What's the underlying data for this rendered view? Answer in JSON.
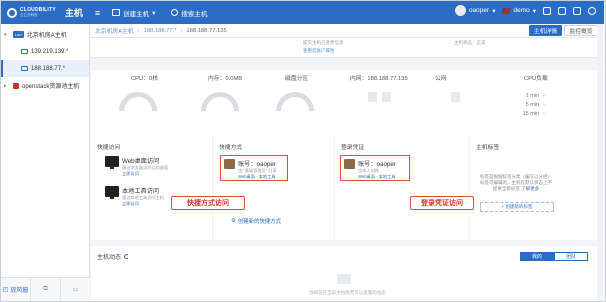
{
  "topbar": {
    "brand": "CLOUDBILITY",
    "brand_sub": "云立方科技",
    "app_title": "主机",
    "menu_icon": "hamburger-icon",
    "create_host": "创建主机",
    "search_host": "搜索主机",
    "user": "oaoper",
    "project": "demo",
    "colors": {
      "bar": "#2b6cc4"
    }
  },
  "sidebar": {
    "items": [
      {
        "toggle": "▾",
        "badge": "Lan",
        "label": "北京机房A主机",
        "level": 0
      },
      {
        "label": "139.219.139.*",
        "level": 1
      },
      {
        "label": "188.188.77.*",
        "level": 1,
        "active": true
      },
      {
        "toggle": "▸",
        "badge": "",
        "label": "openstack资源池主机",
        "level": 0
      }
    ],
    "bottom": {
      "fullscreen": "放风窗",
      "b2": "",
      "b3": ""
    }
  },
  "breadcrumb": {
    "items": [
      "北京机房A主机",
      "188.188.77.*",
      "188.188.77.135"
    ],
    "sep": "›",
    "btn_primary": "主机详情",
    "btn_plain": "监控概览"
  },
  "info_strip": {
    "a": "提交主机已变更信息",
    "b": "查看云账户属性",
    "c": "主机状态：正常"
  },
  "stats": {
    "cpu": "CPU：0核",
    "mem": "内存：0.0MB",
    "disk": "磁盘分区",
    "intranet": "内网：188.188.77.135",
    "public": "公网",
    "load": "CPU负载",
    "load_rows": [
      {
        "k": "1 min",
        "v": "--"
      },
      {
        "k": "5 min",
        "v": "--"
      },
      {
        "k": "15 min",
        "v": "--"
      }
    ]
  },
  "quick_access": {
    "header": "快捷访问",
    "web": {
      "title": "Web桌面访问",
      "sub": "通过浏览器访问远程桌面",
      "link": "立即访问"
    },
    "local": {
      "title": "本地工具访问",
      "sub": "通过本地工具访问主机",
      "link": "立即访问"
    }
  },
  "shortcut": {
    "header": "快捷方式",
    "account_label": "账号：oaoper",
    "account_sub": "由 \"基础管理员\" 分享",
    "links": "Web桌面 · 本地工具",
    "callout": "快捷方式访问",
    "gear_link": "创建新的快捷方式"
  },
  "login_cred": {
    "header": "登录凭证",
    "account_label": "账号：oaoper",
    "account_sub": "由本人创建",
    "links": "Web桌面 · 本地工具",
    "callout": "登录凭证访问"
  },
  "host_tags": {
    "header": "主机标签",
    "text": "标签是根据标签分类（编写以分组）标签可编辑的，主机在默认状态上不提供全新标签",
    "link": "了解更多",
    "add": "+ 创建新的标签"
  },
  "activity": {
    "header": "主机动态",
    "tab_on": "我的",
    "tab_off": "团队",
    "empty": "你目前在当前主机尚无可以查看的动态"
  }
}
